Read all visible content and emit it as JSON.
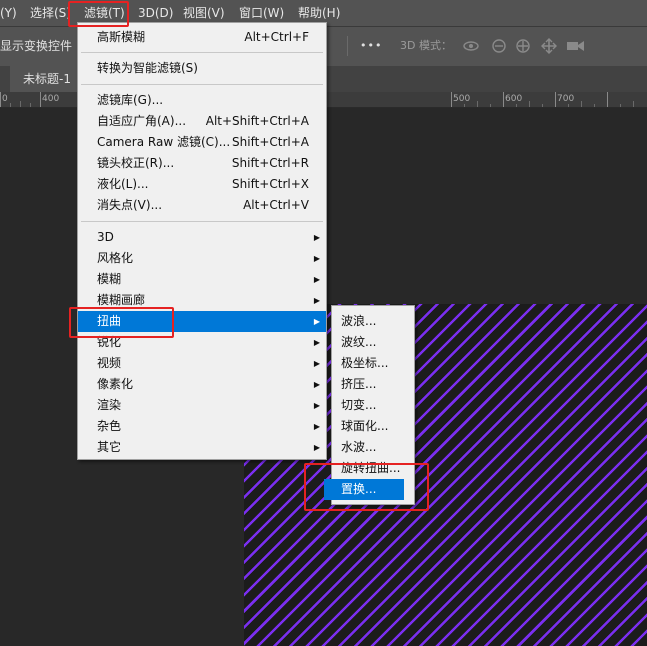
{
  "menubar": {
    "items": [
      {
        "label": "(Y)"
      },
      {
        "label": "选择(S)"
      },
      {
        "label": "滤镜(T)"
      },
      {
        "label": "3D(D)"
      },
      {
        "label": "视图(V)"
      },
      {
        "label": "窗口(W)"
      },
      {
        "label": "帮助(H)"
      }
    ]
  },
  "options_bar": {
    "show_transform_label": "显示变换控件",
    "more_glyph": "•••",
    "mode_3d_label": "3D 模式："
  },
  "document_tab": {
    "title": "未标题-1"
  },
  "ruler": {
    "ticks": [
      "0",
      "400",
      "500",
      "600",
      "700"
    ]
  },
  "filter_menu": {
    "items": [
      {
        "label": "高斯模糊",
        "shortcut": "Alt+Ctrl+F"
      },
      {
        "label": "转换为智能滤镜(S)",
        "shortcut": ""
      },
      {
        "label": "滤镜库(G)...",
        "shortcut": ""
      },
      {
        "label": "自适应广角(A)...",
        "shortcut": "Alt+Shift+Ctrl+A"
      },
      {
        "label": "Camera Raw 滤镜(C)...",
        "shortcut": "Shift+Ctrl+A"
      },
      {
        "label": "镜头校正(R)...",
        "shortcut": "Shift+Ctrl+R"
      },
      {
        "label": "液化(L)...",
        "shortcut": "Shift+Ctrl+X"
      },
      {
        "label": "消失点(V)...",
        "shortcut": "Alt+Ctrl+V"
      },
      {
        "label": "3D",
        "submenu": true
      },
      {
        "label": "风格化",
        "submenu": true
      },
      {
        "label": "模糊",
        "submenu": true
      },
      {
        "label": "模糊画廊",
        "submenu": true
      },
      {
        "label": "扭曲",
        "submenu": true,
        "highlighted": true
      },
      {
        "label": "锐化",
        "submenu": true
      },
      {
        "label": "视频",
        "submenu": true
      },
      {
        "label": "像素化",
        "submenu": true
      },
      {
        "label": "渲染",
        "submenu": true
      },
      {
        "label": "杂色",
        "submenu": true
      },
      {
        "label": "其它",
        "submenu": true
      }
    ]
  },
  "distort_submenu": {
    "items": [
      {
        "label": "波浪..."
      },
      {
        "label": "波纹..."
      },
      {
        "label": "极坐标..."
      },
      {
        "label": "挤压..."
      },
      {
        "label": "切变..."
      },
      {
        "label": "球面化..."
      },
      {
        "label": "水波..."
      },
      {
        "label": "旋转扭曲..."
      },
      {
        "label": "置换...",
        "highlighted": true
      }
    ]
  },
  "colors": {
    "highlight": "#0078d7",
    "annotation_box": "#e52222",
    "stripe": "#7a2ef0"
  },
  "submenu_arrow_glyph": "▶"
}
